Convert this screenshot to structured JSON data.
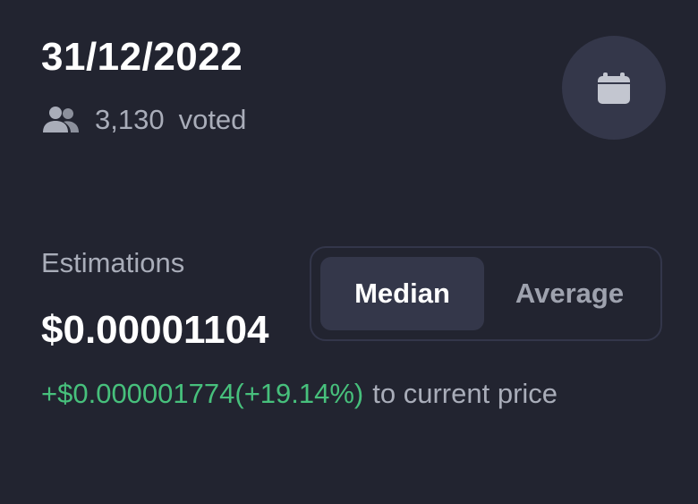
{
  "header": {
    "date": "31/12/2022",
    "voted_count": "3,130",
    "voted_label": "voted",
    "icons": {
      "users": "users-icon",
      "calendar": "calendar-icon"
    }
  },
  "estimations": {
    "label": "Estimations",
    "value": "$0.00001104",
    "difference": "+$0.000001774(+19.14%)",
    "difference_suffix": "to current price",
    "mode_options": [
      "Median",
      "Average"
    ],
    "selected_mode": "Median"
  },
  "colors": {
    "background": "#222430",
    "positive": "#47c07c",
    "muted_text": "#a9adb9",
    "surface": "#34374a"
  }
}
